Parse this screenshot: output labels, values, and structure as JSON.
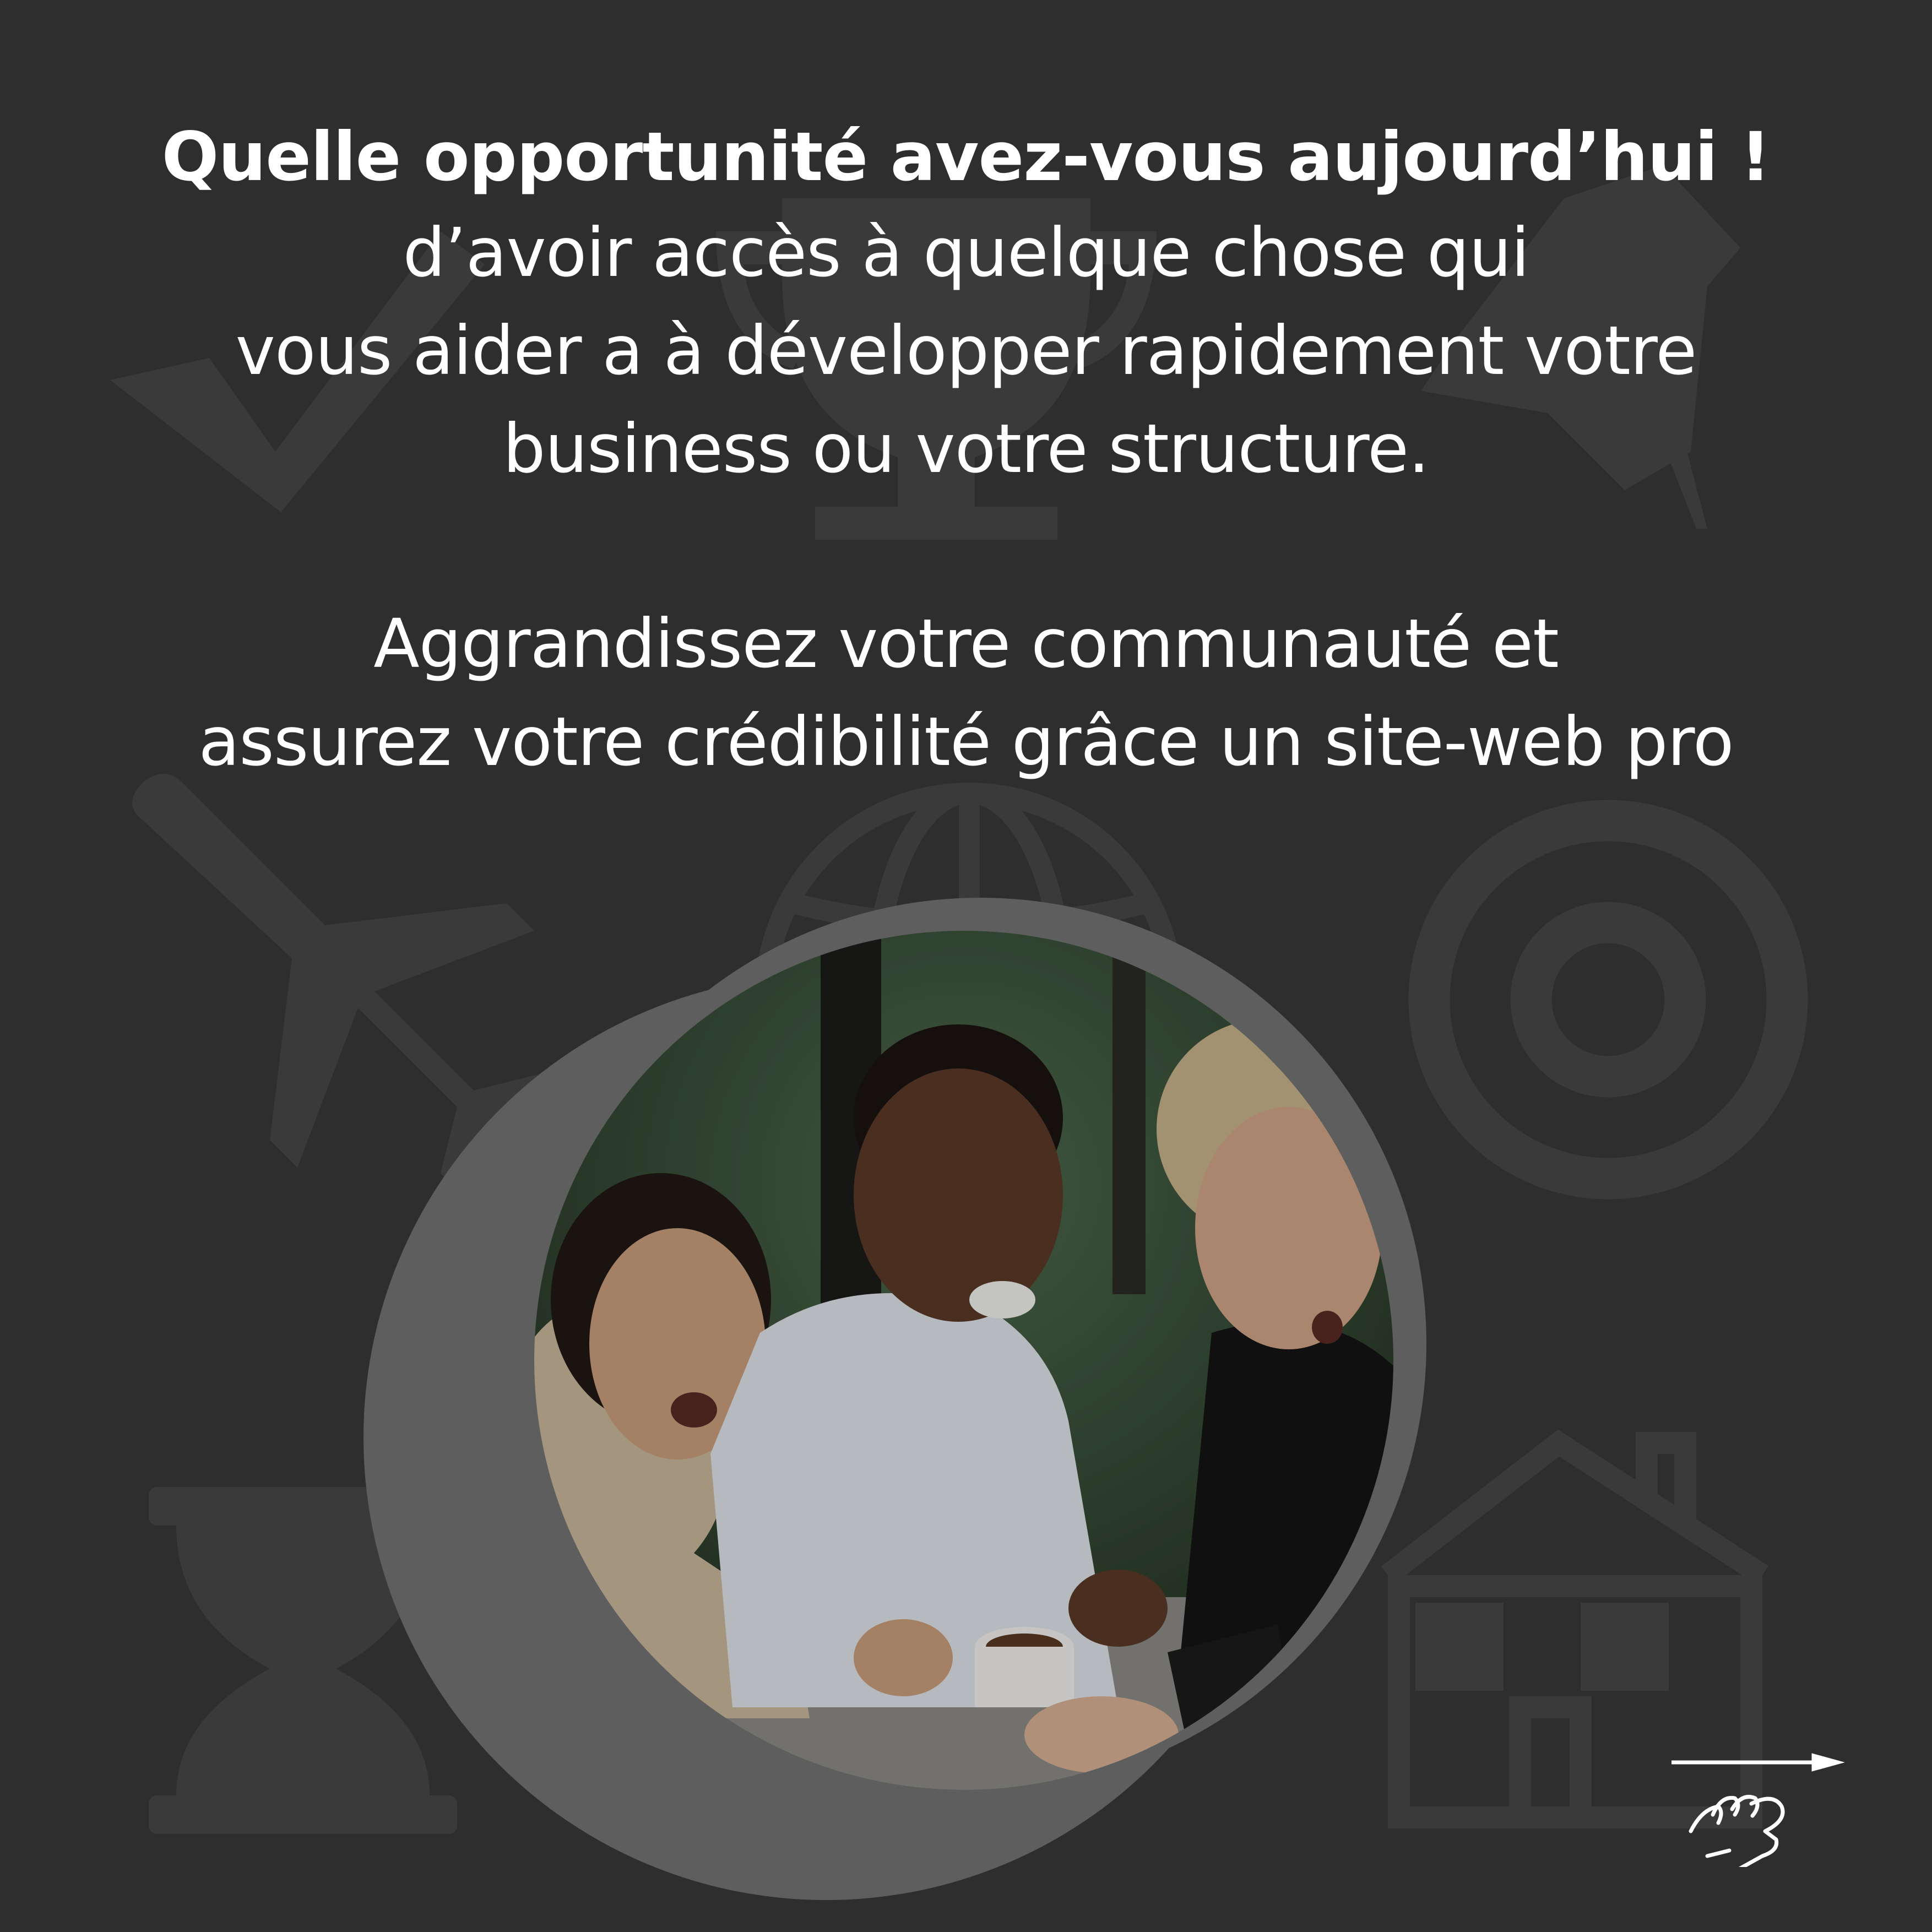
{
  "text": {
    "headline": "Quelle opportunité avez-vous aujourd’hui !",
    "line1": "d’avoir accès à quelque chose qui",
    "line2": "vous aider a à développer rapidement votre",
    "line3": "business ou votre structure.",
    "line4": "Aggrandissez votre communauté et",
    "line5": "assurez votre crédibilité grâce un site-web pro"
  },
  "colors": {
    "background": "#2e2e2e",
    "icon_watermark": "#3a3a3a",
    "circle_frame": "#5f5e5f",
    "text": "#ffffff"
  },
  "icons": {
    "background": [
      "checkmark-icon",
      "trophy-icon",
      "pushpin-icon",
      "airplane-icon",
      "globe-icon",
      "target-icon",
      "hourglass-icon",
      "house-icon"
    ],
    "navigation": [
      "arrow-right-icon",
      "swipe-hand-icon"
    ]
  },
  "photo": {
    "subject": "three people looking at a phone in a cafe"
  }
}
